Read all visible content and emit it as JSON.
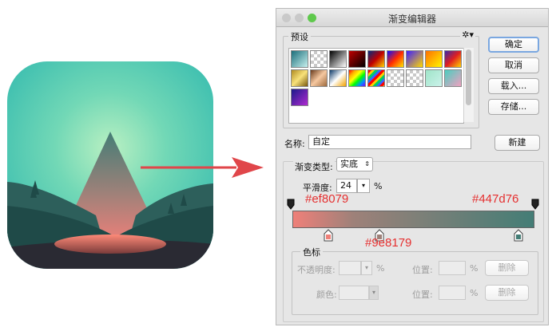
{
  "window": {
    "title": "渐变编辑器"
  },
  "presets": {
    "label": "预设",
    "menu_icon": "gear-icon",
    "swatches": [
      "linear-gradient(135deg,#1b6e7a,#c7f0ee)",
      "checker-white",
      "linear-gradient(135deg,#000,#fff)",
      "linear-gradient(135deg,#c00000,#000)",
      "linear-gradient(135deg,#002a7f,#c00000,#ffd400)",
      "linear-gradient(135deg,#0a0aff,#ff2a00,#ffe600)",
      "linear-gradient(135deg,#3d1dff,#ffd900)",
      "linear-gradient(135deg,#ff7000,#fff600)",
      "linear-gradient(135deg,#3a2aa8,#e02020,#ffd200)",
      "linear-gradient(135deg,#b08a20,#f8e27a,#7a5a10)",
      "linear-gradient(135deg,#6a3b1c,#f6c8a0,#9e6a3e)",
      "linear-gradient(135deg,#0d3a6a,#ffffff,#f2a200)",
      "linear-gradient(135deg,#ff0000,#ffaa00,#ffff00,#00ff00,#0090ff,#8000ff)",
      "repeating-linear-gradient(135deg,#ff0000 0 3px,#ffcc00 3px 6px,#00cc66 6px 9px,#3366ff 9px 12px)",
      "checker-rainbow",
      "checker-white",
      "linear-gradient(135deg,#9fe4c8,#cbf2ea)",
      "linear-gradient(135deg,#4acdbf,#f0a0c0)",
      "linear-gradient(135deg,#1a1a8a,#b02ad0)"
    ]
  },
  "buttons": {
    "ok": "确定",
    "cancel": "取消",
    "load": "载入...",
    "save": "存储...",
    "new": "新建",
    "delete": "删除"
  },
  "name": {
    "label": "名称:",
    "value": "自定"
  },
  "gradient_type": {
    "label": "渐变类型:",
    "value": "实底"
  },
  "smoothness": {
    "label": "平滑度:",
    "value": "24",
    "unit": "%"
  },
  "gradient": {
    "stops": [
      "#ef8079",
      "#9e8179",
      "#447d76"
    ]
  },
  "color_stops": {
    "label": "色标",
    "opacity_label": "不透明度:",
    "color_label": "颜色:",
    "position_label": "位置:",
    "percent": "%"
  },
  "annotations": {
    "left_color": "#ef8079",
    "right_color": "#447d76",
    "mid_color": "#9e8179"
  }
}
